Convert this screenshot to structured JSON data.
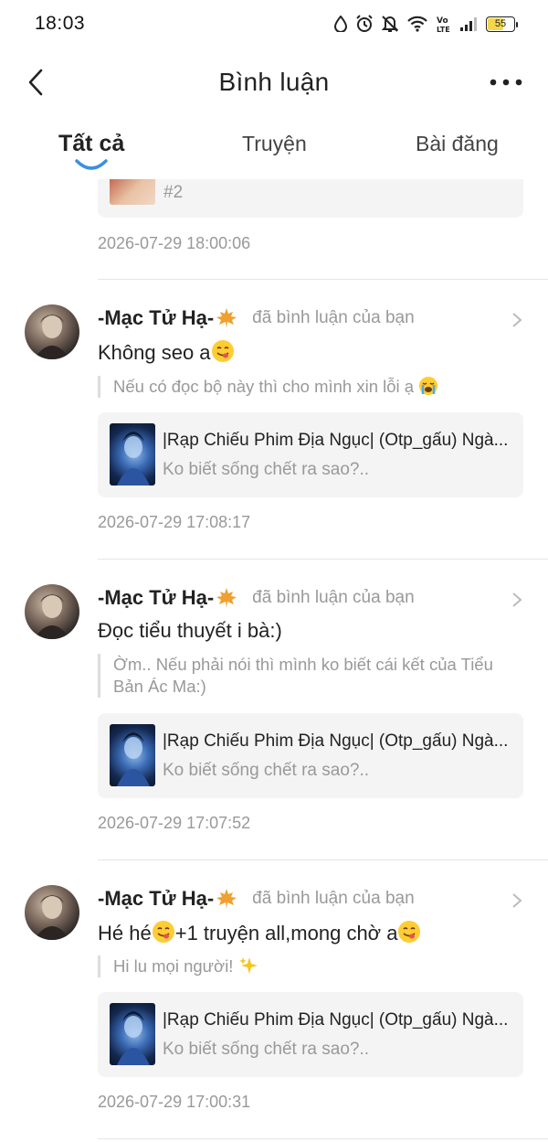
{
  "status_bar": {
    "time": "18:03",
    "battery": "55",
    "icons": [
      "water-drop-icon",
      "alarm-icon",
      "mute-bell-icon",
      "wifi-icon",
      "volte-icon",
      "signal-icon",
      "battery-icon"
    ]
  },
  "header": {
    "title": "Bình luận",
    "back_icon": "chevron-left-icon",
    "more_icon": "more-dots-icon"
  },
  "tabs": [
    {
      "label": "Tất cả",
      "active": true
    },
    {
      "label": "Truyện",
      "active": false
    },
    {
      "label": "Bài đăng",
      "active": false
    }
  ],
  "partial_item": {
    "card_text": "#2",
    "timestamp": "2026-07-29 18:00:06"
  },
  "comments": [
    {
      "user": "-Mạc Tử Hạ-",
      "action": "đã bình luận của bạn",
      "text": "Không seo a",
      "text_suffix": "",
      "quote": "Nếu có đọc bộ này thì cho mình xin lỗi ạ",
      "story_title": "|Rạp Chiếu Phim Địa Ngục| (Otp_gấu) Ngà...",
      "story_subtitle": "Ko biết sống chết ra sao?..",
      "timestamp": "2026-07-29 17:08:17"
    },
    {
      "user": "-Mạc Tử Hạ-",
      "action": "đã bình luận của bạn",
      "text": "Đọc tiểu thuyết i bà:)",
      "quote_line1": "Ờm.. Nếu phải nói thì mình ko biết cái kết của Tiểu",
      "quote_line2": "Bản Ác Ma:)",
      "story_title": "|Rạp Chiếu Phim Địa Ngục| (Otp_gấu) Ngà...",
      "story_subtitle": "Ko biết sống chết ra sao?..",
      "timestamp": "2026-07-29 17:07:52"
    },
    {
      "user": "-Mạc Tử Hạ-",
      "action": "đã bình luận của bạn",
      "text_part1": "Hé hé",
      "text_part2": "+1 truyện all,mong chờ a",
      "quote": "Hi lu mọi người!",
      "story_title": "|Rạp Chiếu Phim Địa Ngục| (Otp_gấu) Ngà...",
      "story_subtitle": "Ko biết sống chết ra sao?..",
      "timestamp": "2026-07-29 17:00:31"
    }
  ],
  "colors": {
    "accent": "#3d8fe0",
    "muted_text": "#999999",
    "card_bg": "#f4f4f4",
    "leaf": "#f0a030"
  }
}
